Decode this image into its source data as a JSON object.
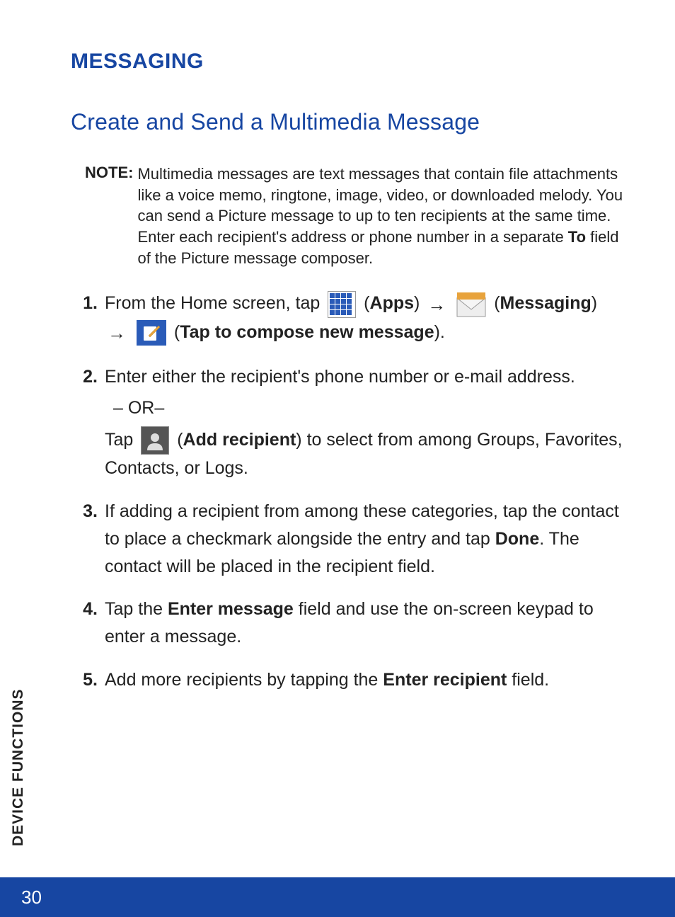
{
  "sidebar_label": "DEVICE FUNCTIONS",
  "page_number": "30",
  "heading1": "MESSAGING",
  "heading2": "Create and Send a Multimedia Message",
  "note": {
    "label": "NOTE:",
    "body_pre": "Multimedia messages are text messages that contain file attachments like a voice memo, ringtone, image, video, or downloaded melody. You can send a Picture message to up to ten recipients at the same time. Enter each recipient's address or phone number in a separate ",
    "to_word": "To",
    "body_post": " field of the Picture message composer."
  },
  "steps": {
    "s1": {
      "num": "1.",
      "t1": "From the Home screen, tap ",
      "apps_label": "Apps",
      "messaging_label": "Messaging",
      "compose_label": "Tap to compose new message"
    },
    "s2": {
      "num": "2.",
      "t1": "Enter either the recipient's phone number or e-mail address.",
      "or": "– OR–",
      "t2a": "Tap ",
      "add_recipient_label": "Add recipient",
      "t2b": " to select from among Groups, Favorites, Contacts, or Logs."
    },
    "s3": {
      "num": "3.",
      "t1": "If adding a recipient from among these categories, tap the contact to place a checkmark alongside the entry and tap ",
      "done": "Done",
      "t2": ". The contact will be placed in the recipient field."
    },
    "s4": {
      "num": "4.",
      "t1": "Tap the ",
      "enter_message": "Enter message",
      "t2": " field and use the on-screen keypad to enter a message."
    },
    "s5": {
      "num": "5.",
      "t1": "Add more recipients by tapping the ",
      "enter_recipient": "Enter recipient",
      "t2": " field."
    }
  }
}
